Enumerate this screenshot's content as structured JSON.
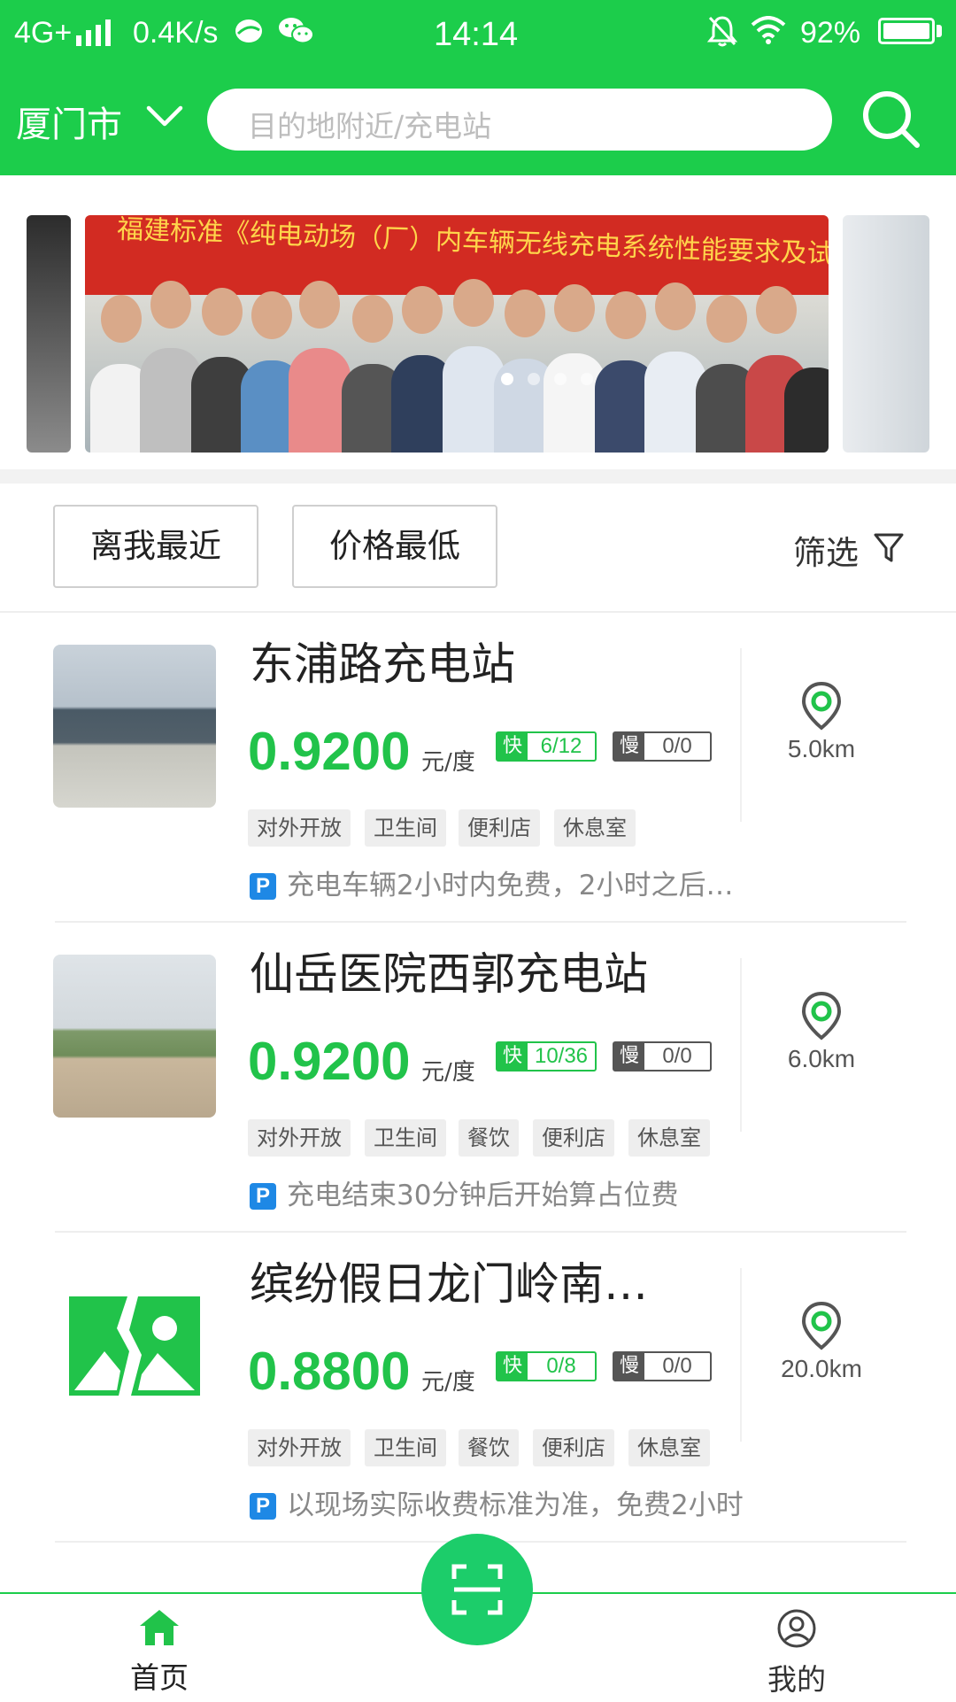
{
  "status_bar": {
    "network": "4G+",
    "speed": "0.4K/s",
    "time": "14:14",
    "battery": "92%"
  },
  "header": {
    "city": "厦门市",
    "search_placeholder": "目的地附近/充电站"
  },
  "banner": {
    "caption": "福建标准《纯电动场（厂）内车辆无线充电系统性能要求及试验方法》送审稿审查会",
    "dots_total": 4,
    "active_dot": 1
  },
  "filters": {
    "nearest": "离我最近",
    "cheapest": "价格最低",
    "filter": "筛选"
  },
  "stations": [
    {
      "name": "东浦路充电站",
      "price": "0.9200",
      "unit": "元/度",
      "fast_label": "快",
      "fast": "6/12",
      "slow_label": "慢",
      "slow": "0/0",
      "facilities": [
        "对外开放",
        "卫生间",
        "便利店",
        "休息室"
      ],
      "parking_note": "充电车辆2小时内免费，2小时之后…",
      "distance": "5.0km"
    },
    {
      "name": "仙岳医院西郭充电站",
      "price": "0.9200",
      "unit": "元/度",
      "fast_label": "快",
      "fast": "10/36",
      "slow_label": "慢",
      "slow": "0/0",
      "facilities": [
        "对外开放",
        "卫生间",
        "餐饮",
        "便利店",
        "休息室"
      ],
      "parking_note": "充电结束30分钟后开始算占位费",
      "distance": "6.0km"
    },
    {
      "name": "缤纷假日龙门岭南…",
      "price": "0.8800",
      "unit": "元/度",
      "fast_label": "快",
      "fast": "0/8",
      "slow_label": "慢",
      "slow": "0/0",
      "facilities": [
        "对外开放",
        "卫生间",
        "餐饮",
        "便利店",
        "休息室"
      ],
      "parking_note": "以现场实际收费标准为准，免费2小时",
      "distance": "20.0km"
    }
  ],
  "parking_badge": "P",
  "bottom_nav": {
    "home": "首页",
    "mine": "我的"
  },
  "colors": {
    "brand_green": "#1ccd4b",
    "price_green": "#21c34a",
    "parking_blue": "#1e88e5"
  }
}
